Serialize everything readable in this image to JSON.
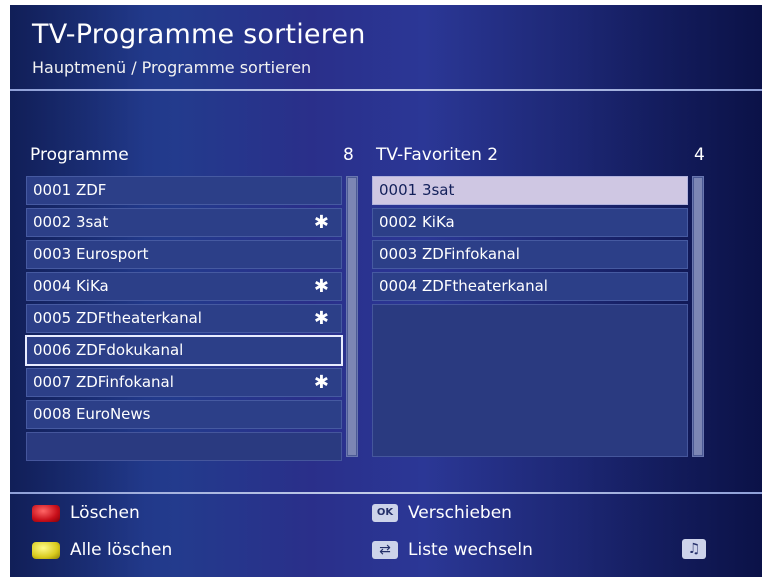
{
  "header": {
    "title": "TV-Programme sortieren",
    "breadcrumb": "Hauptmenü / Programme sortieren"
  },
  "programme": {
    "heading": "Programme",
    "count": "8",
    "items": [
      {
        "label": "0001  ZDF",
        "star": ""
      },
      {
        "label": "0002  3sat",
        "star": "✱"
      },
      {
        "label": "0003  Eurosport",
        "star": ""
      },
      {
        "label": "0004  KiKa",
        "star": "✱"
      },
      {
        "label": "0005  ZDFtheaterkanal",
        "star": "✱"
      },
      {
        "label": "0006  ZDFdokukanal",
        "star": ""
      },
      {
        "label": "0007  ZDFinfokanal",
        "star": "✱"
      },
      {
        "label": "0008  EuroNews",
        "star": ""
      }
    ],
    "focused_index": 5
  },
  "favoriten": {
    "heading": "TV-Favoriten 2",
    "count": "4",
    "items": [
      {
        "label": "0001  3sat"
      },
      {
        "label": "0002  KiKa"
      },
      {
        "label": "0003  ZDFinfokanal"
      },
      {
        "label": "0004  ZDFtheaterkanal"
      }
    ],
    "selected_index": 0
  },
  "legend": {
    "red_label": "Löschen",
    "yellow_label": "Alle löschen",
    "ok_key": "OK",
    "ok_label": "Verschieben",
    "swap_key": "⇄",
    "swap_label": "Liste wechseln",
    "music_key": "♫"
  },
  "colors": {
    "background": "#233b8d",
    "row": "#2c3f88",
    "selected_row": "#cfc7e3",
    "red_key": "#c80f1a",
    "yellow_key": "#d9cb1e"
  }
}
